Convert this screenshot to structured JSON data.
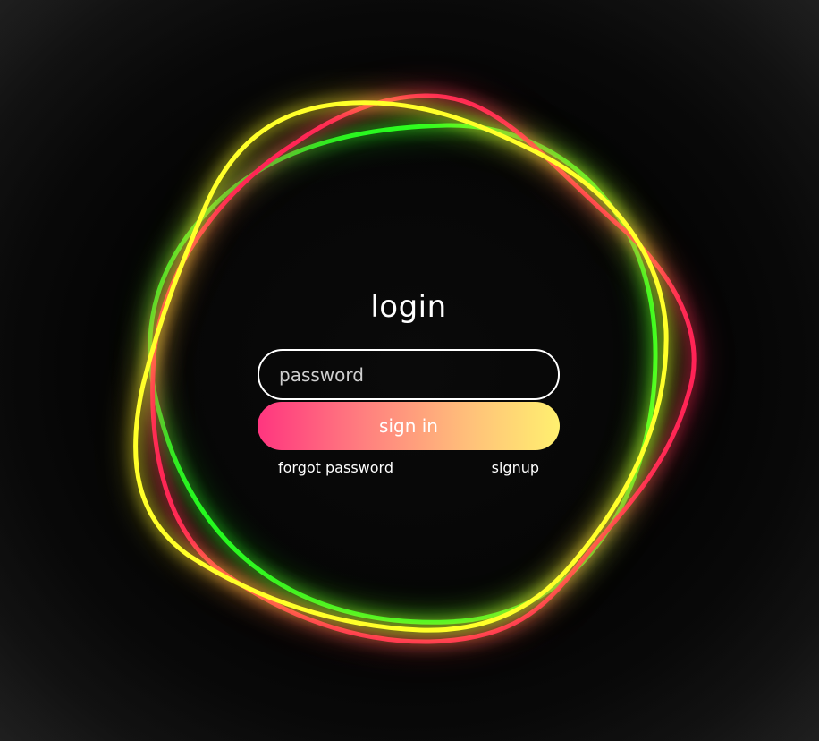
{
  "login": {
    "title": "login",
    "password_placeholder": "password",
    "signin_label": "sign in",
    "forgot_label": "forgot password",
    "signup_label": "signup"
  },
  "colors": {
    "background": "#000000",
    "ring_red": "#ff1f57",
    "ring_green": "#1fff1f",
    "ring_yellow": "#ffff2a",
    "button_gradient_start": "#ff357f",
    "button_gradient_end": "#fff06f",
    "text": "#ffffff"
  }
}
